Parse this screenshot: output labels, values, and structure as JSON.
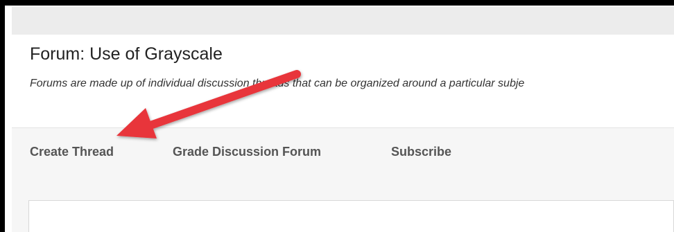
{
  "page": {
    "title": "Forum: Use of Grayscale",
    "description": "Forums are made up of individual discussion threads that can be organized around a particular subje"
  },
  "actions": {
    "create_thread": "Create Thread",
    "grade_forum": "Grade Discussion Forum",
    "subscribe": "Subscribe"
  },
  "annotation": {
    "arrow_color": "#e8353b",
    "target": "Create Thread"
  }
}
